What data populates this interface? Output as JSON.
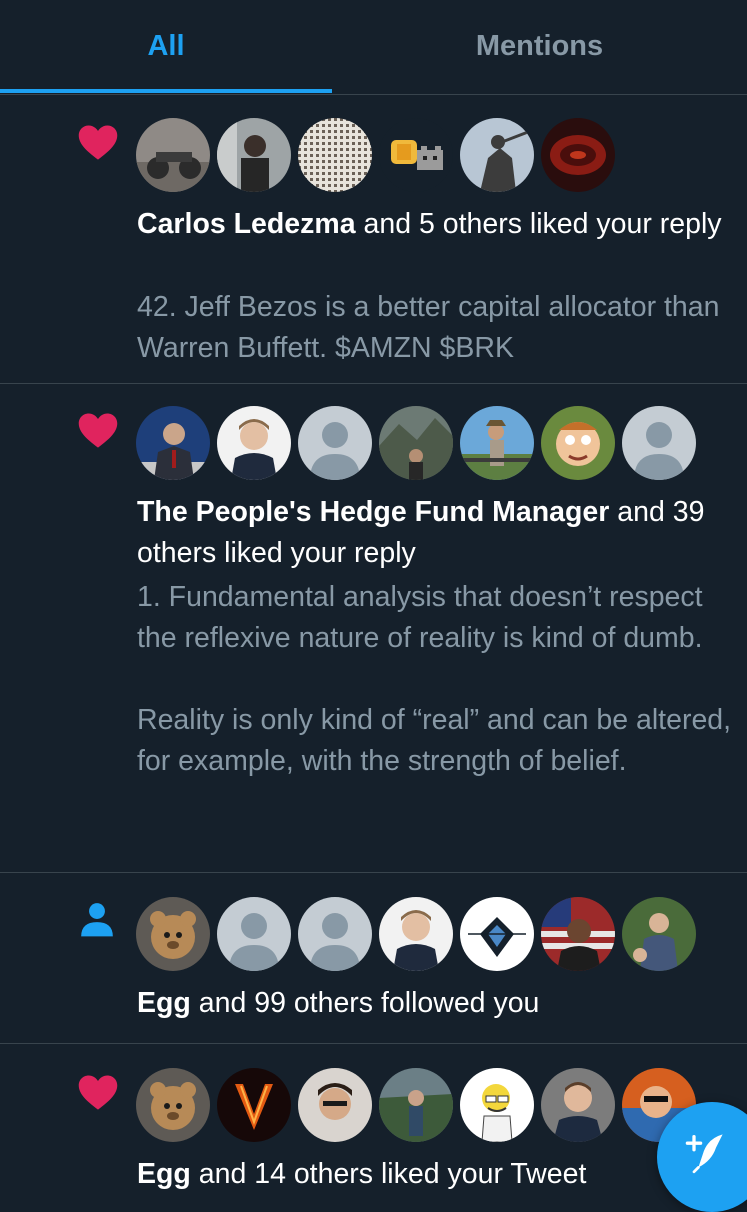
{
  "tabs": {
    "all": "All",
    "mentions": "Mentions"
  },
  "colors": {
    "accent": "#1da1f2",
    "like": "#e0245e",
    "background": "#15202b",
    "muted": "#8899a6",
    "divider": "#38444d"
  },
  "notifications": [
    {
      "type": "like",
      "icon": "heart-icon",
      "actor": "Carlos Ledezma",
      "summary": " and 5 others liked your reply",
      "body": "42. Jeff Bezos is a better capital allocator than Warren Buffett. $AMZN $BRK",
      "avatar_count": 6
    },
    {
      "type": "like",
      "icon": "heart-icon",
      "actor": "The People's Hedge Fund Manager",
      "summary": " and 39 others liked your reply",
      "body": "1. Fundamental analysis that doesn’t respect the reflexive nature of reality is kind of dumb.\n\nReality is only kind of “real” and can be altered, for example, with the strength of belief.",
      "avatar_count": 7
    },
    {
      "type": "follow",
      "icon": "person-icon",
      "actor": "Egg",
      "summary": " and 99 others followed you",
      "avatar_count": 7
    },
    {
      "type": "like",
      "icon": "heart-icon",
      "actor": "Egg",
      "summary": " and 14 others liked your Tweet",
      "avatar_count": 7
    }
  ],
  "fab": {
    "icon": "compose-tweet-icon"
  }
}
